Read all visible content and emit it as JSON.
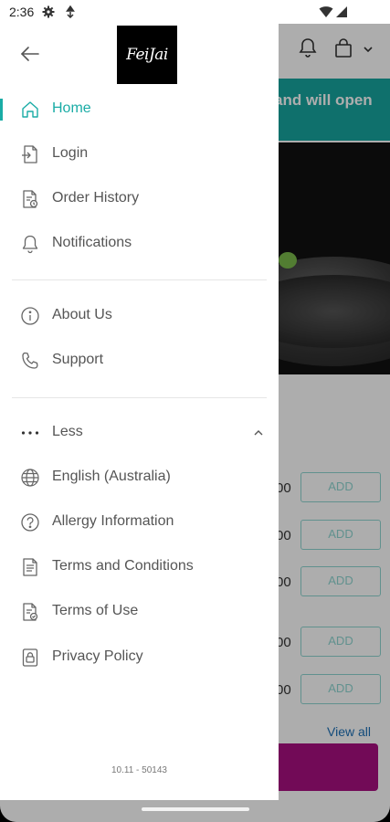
{
  "status_bar": {
    "time": "2:36",
    "icons": [
      "gear-icon",
      "data-saver-icon",
      "wifi-icon",
      "signal-icon"
    ]
  },
  "background": {
    "banner_text": "and will open",
    "rows": [
      {
        "price": "00",
        "add": "ADD"
      },
      {
        "price": "00",
        "add": "ADD"
      },
      {
        "price": "00",
        "add": "ADD"
      },
      {
        "price": "00",
        "add": "ADD"
      },
      {
        "price": "00",
        "add": "ADD"
      }
    ],
    "view_all": "View all",
    "icons": [
      "bell-icon",
      "shopping-bag-icon",
      "chevron-down-icon"
    ],
    "colors": {
      "banner": "#17a6a0",
      "cta": "#a81080",
      "add_border": "#8fd6d2"
    }
  },
  "drawer": {
    "logo_text": "FeiJai",
    "menu": [
      {
        "label": "Home",
        "icon": "home-icon",
        "active": true
      },
      {
        "label": "Login",
        "icon": "login-icon"
      },
      {
        "label": "Order History",
        "icon": "receipt-icon"
      },
      {
        "label": "Notifications",
        "icon": "bell-icon"
      }
    ],
    "secondary": [
      {
        "label": "About Us",
        "icon": "info-icon"
      },
      {
        "label": "Support",
        "icon": "phone-icon"
      }
    ],
    "more": [
      {
        "label": "Less",
        "icon": "more-horizontal-icon"
      },
      {
        "label": "English (Australia)",
        "icon": "globe-icon"
      },
      {
        "label": "Allergy Information",
        "icon": "question-icon"
      },
      {
        "label": "Terms and Conditions",
        "icon": "document-icon"
      },
      {
        "label": "Terms of Use",
        "icon": "document-check-icon"
      },
      {
        "label": "Privacy Policy",
        "icon": "privacy-icon"
      }
    ],
    "version": "10.11 - 50143",
    "colors": {
      "accent": "#1aaca6",
      "text": "#555555"
    }
  }
}
